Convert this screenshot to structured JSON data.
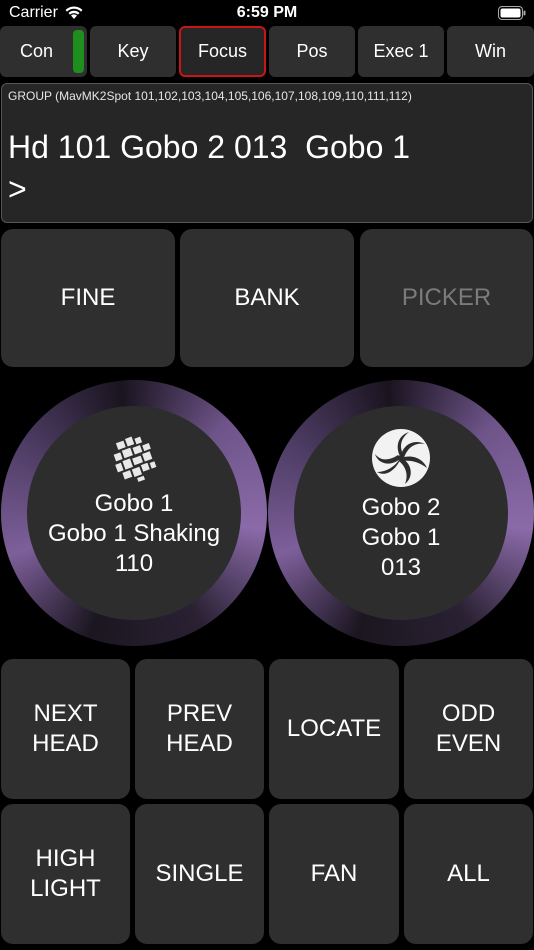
{
  "status_bar": {
    "carrier": "Carrier",
    "time": "6:59 PM"
  },
  "tabs": [
    {
      "label": "Con",
      "active": false
    },
    {
      "label": "Key",
      "active": false
    },
    {
      "label": "Focus",
      "active": true
    },
    {
      "label": "Pos",
      "active": false
    },
    {
      "label": "Exec 1",
      "active": false
    },
    {
      "label": "Win",
      "active": false
    }
  ],
  "command": {
    "group": "GROUP (MavMK2Spot 101,102,103,104,105,106,107,108,109,110,111,112)",
    "line": "Hd 101 Gobo 2 013  Gobo 1",
    "prompt": ">"
  },
  "mode_buttons": {
    "fine": "FINE",
    "bank": "BANK",
    "picker": "PICKER"
  },
  "encoders": [
    {
      "line1": "Gobo 1",
      "line2": "Gobo 1 Shaking",
      "line3": "110",
      "icon": "gobo-shattered-icon"
    },
    {
      "line1": "Gobo 2",
      "line2": "Gobo 1",
      "line3": "013",
      "icon": "gobo-spiral-icon"
    }
  ],
  "bottom_buttons": {
    "next_head": "NEXT\nHEAD",
    "prev_head": "PREV\nHEAD",
    "locate": "LOCATE",
    "odd_even": "ODD\nEVEN",
    "highlight": "HIGH\nLIGHT",
    "single": "SINGLE",
    "fan": "FAN",
    "all": "ALL"
  },
  "colors": {
    "active_tab_border": "#cc1414",
    "indicator": "#1e8f1e",
    "encoder_ring": "#7d5f9a"
  }
}
